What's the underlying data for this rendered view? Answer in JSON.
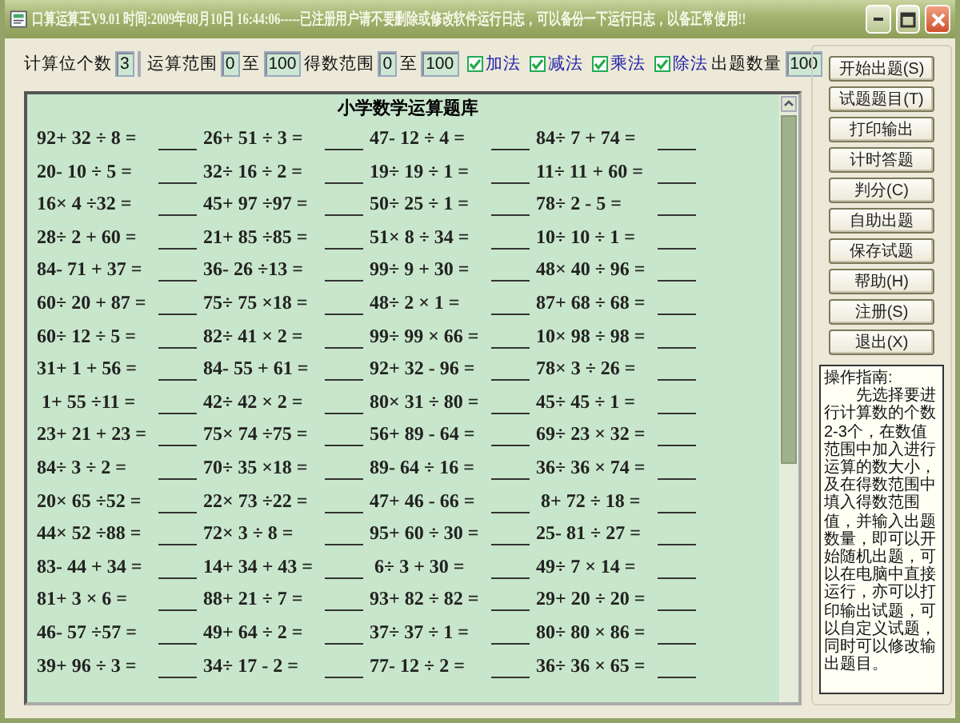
{
  "window": {
    "title": "口算运算王V9.01   时间:2009年08月10日 16:44:06-----已注册用户请不要删除或修改软件运行日志，可以备份一下运行日志，以备正常使用!!"
  },
  "toolbar": {
    "digit_count": {
      "label": "计算位个数",
      "value": "3"
    },
    "operand_range": {
      "label": "运算范围",
      "from": "0",
      "to_label": "至",
      "to": "100"
    },
    "result_range": {
      "label": "得数范围",
      "from": "0",
      "to_label": "至",
      "to": "100"
    },
    "operations": [
      {
        "label": "加法",
        "checked": true
      },
      {
        "label": "减法",
        "checked": true
      },
      {
        "label": "乘法",
        "checked": true
      },
      {
        "label": "除法",
        "checked": true
      }
    ],
    "quantity": {
      "label": "出题数量",
      "value": "100"
    }
  },
  "sheet": {
    "title": "小学数学运算题库",
    "rows": [
      [
        "92+ 32 ÷ 8 =",
        "26+ 51 ÷ 3 =",
        "47- 12 ÷ 4 =",
        "84÷ 7 + 74 ="
      ],
      [
        "20- 10 ÷ 5 =",
        "32÷ 16 ÷ 2 =",
        "19÷ 19 ÷ 1 =",
        "11÷ 11 + 60 ="
      ],
      [
        "16× 4 ÷32 =",
        "45+ 97 ÷97 =",
        "50÷ 25 ÷ 1 =",
        "78÷ 2 - 5 ="
      ],
      [
        "28÷ 2 + 60 =",
        "21+ 85 ÷85 =",
        "51× 8 ÷ 34 =",
        "10÷ 10 ÷ 1 ="
      ],
      [
        "84- 71 + 37 =",
        "36- 26 ÷13 =",
        "99÷ 9 + 30 =",
        "48× 40 ÷ 96 ="
      ],
      [
        "60÷ 20 + 87 =",
        "75÷ 75 ×18 =",
        "48÷ 2 × 1 =",
        "87+ 68 ÷ 68 ="
      ],
      [
        "60÷ 12 ÷ 5 =",
        "82÷ 41 × 2 =",
        "99÷ 99 × 66 =",
        "10× 98 ÷ 98 ="
      ],
      [
        "31+ 1 + 56 =",
        "84- 55 + 61 =",
        "92+ 32 - 96 =",
        "78× 3 ÷ 26 ="
      ],
      [
        " 1+ 55 ÷11 =",
        "42÷ 42 × 2 =",
        "80× 31 ÷ 80 =",
        "45÷ 45 ÷ 1 ="
      ],
      [
        "23+ 21 + 23 =",
        "75× 74 ÷75 =",
        "56+ 89 - 64 =",
        "69÷ 23 × 32 ="
      ],
      [
        "84÷ 3 ÷ 2 =",
        "70÷ 35 ×18 =",
        "89- 64 ÷ 16 =",
        "36÷ 36 × 74 ="
      ],
      [
        "20× 65 ÷52 =",
        "22× 73 ÷22 =",
        "47+ 46 - 66 =",
        " 8+ 72 ÷ 18 ="
      ],
      [
        "44× 52 ÷88 =",
        "72× 3 ÷ 8 =",
        "95+ 60 ÷ 30 =",
        "25- 81 ÷ 27 ="
      ],
      [
        "83- 44 + 34 =",
        "14+ 34 + 43 =",
        " 6÷ 3 + 30 =",
        "49÷ 7 × 14 ="
      ],
      [
        "81+ 3 × 6 =",
        "88+ 21 ÷ 7 =",
        "93+ 82 ÷ 82 =",
        "29+ 20 ÷ 20 ="
      ],
      [
        "46- 57 ÷57 =",
        "49+ 64 ÷ 2 =",
        "37÷ 37 ÷ 1 =",
        "80÷ 80 × 86 ="
      ],
      [
        "39+ 96 ÷ 3 =",
        "34÷ 17 - 2 =",
        "77- 12 ÷ 2 =",
        "36÷ 36 × 65 ="
      ]
    ]
  },
  "buttons": [
    "开始出题(S)",
    "试题题目(T)",
    "打印输出",
    "计时答题",
    "判分(C)",
    "自助出题",
    "保存试题",
    "帮助(H)",
    "注册(S)",
    "退出(X)"
  ],
  "guide": {
    "title": "操作指南:",
    "text": "先选择要进行计算数的个数2-3个，在数值范围中加入进行运算的数大小，及在得数范围中填入得数范围值，并输入出题数量，即可以开始随机出题，可以在电脑中直接运行，亦可以打印输出试题，可以自定义试题，同时可以修改输出题目。"
  }
}
